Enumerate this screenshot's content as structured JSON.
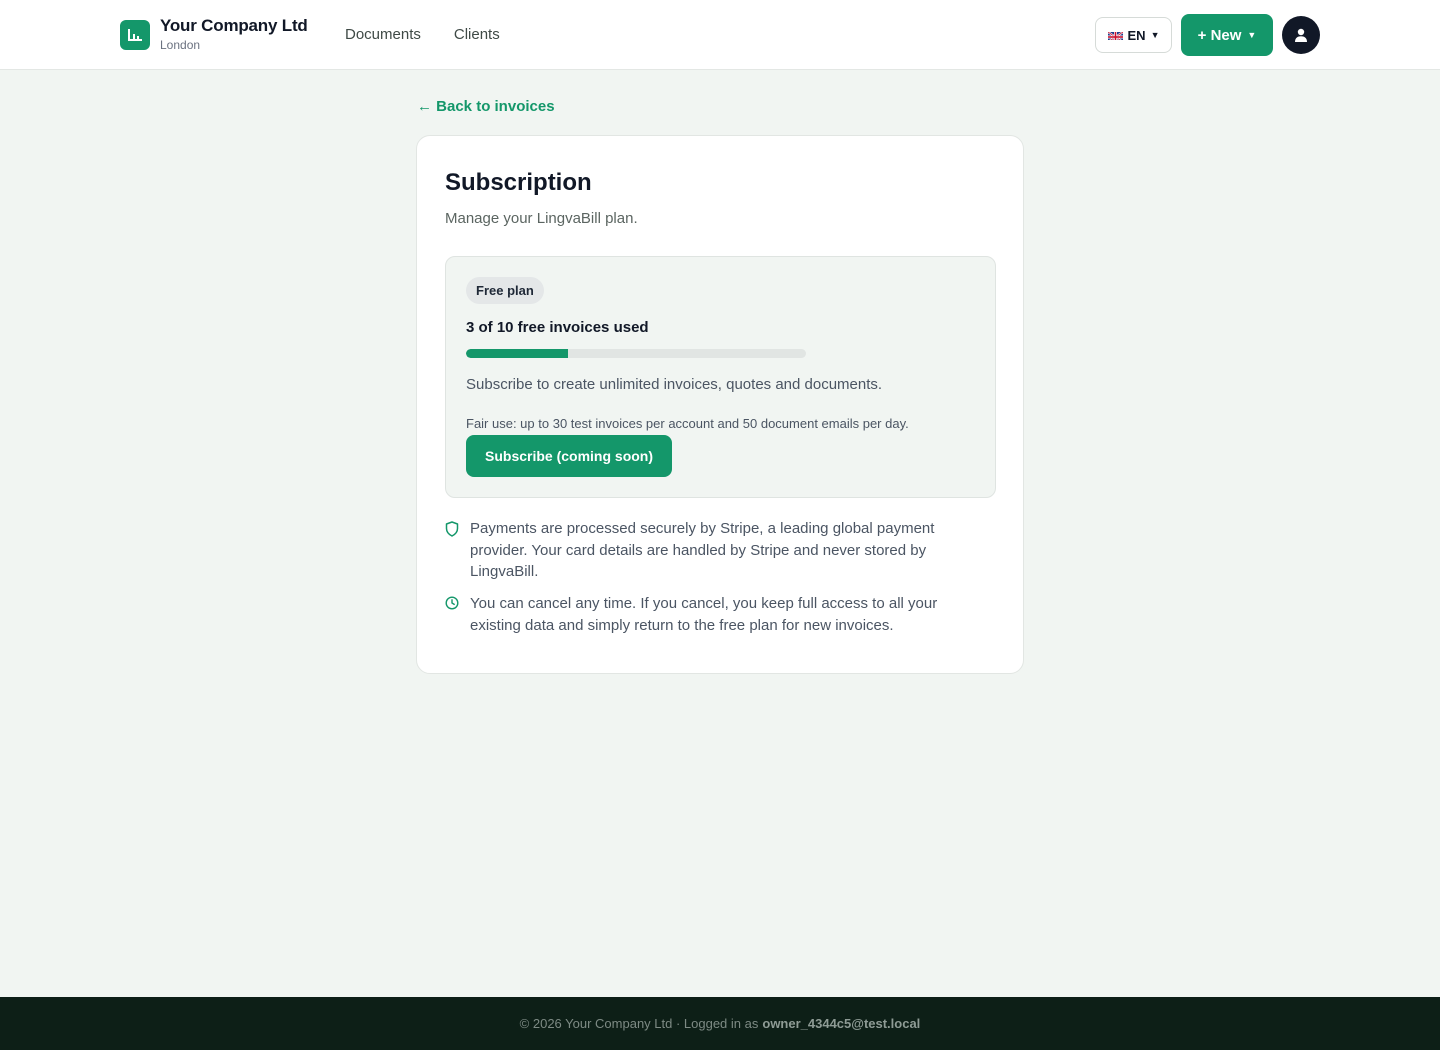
{
  "brand": {
    "name": "Your Company Ltd",
    "city": "London",
    "logo_icon": "chart-bars-icon",
    "color": "#14976a"
  },
  "nav": {
    "documents": "Documents",
    "clients": "Clients"
  },
  "language": {
    "code": "EN",
    "flag": "uk-flag-icon"
  },
  "new_button": {
    "label": "+ New"
  },
  "user": {
    "avatar_icon": "user-icon"
  },
  "back_link": "← Back to invoices",
  "subscription": {
    "title": "Subscription",
    "subtitle": "Manage your LingvaBill plan.",
    "plan_badge": "Free plan",
    "usage_text": "3 of 10 free invoices used",
    "used": 3,
    "limit": 10,
    "description": "Subscribe to create unlimited invoices, quotes and documents.",
    "fair_use": "Fair use: up to 30 test invoices per account and 50 document emails per day.",
    "subscribe_button": "Subscribe (coming soon)"
  },
  "notes": [
    {
      "icon": "shield-icon",
      "text": "Payments are processed securely by Stripe, a leading global payment provider. Your card details are handled by Stripe and never stored by LingvaBill."
    },
    {
      "icon": "clock-icon",
      "text": "You can cancel any time. If you cancel, you keep full access to all your existing data and simply return to the free plan for new invoices."
    }
  ],
  "footer": {
    "text": "© 2026 Your Company Ltd · Logged in as",
    "email": "owner_4344c5@test.local"
  }
}
